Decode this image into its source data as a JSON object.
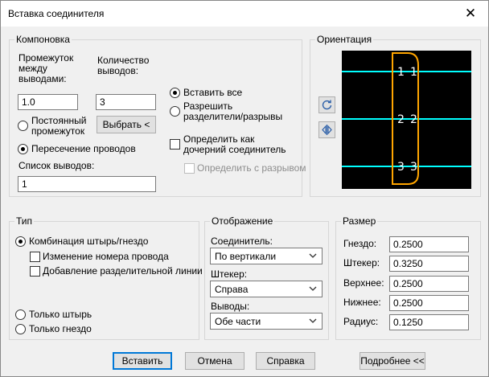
{
  "window": {
    "title": "Вставка соединителя"
  },
  "layout_group": {
    "label": "Компоновка",
    "spacing_label": "Промежуток между выводами:",
    "count_label": "Количество выводов:",
    "spacing_value": "1.0",
    "count_value": "3",
    "constant_spacing_label": "Постоянный промежуток",
    "select_button": "Выбрать <",
    "wire_intersection_label": "Пересечение проводов",
    "pin_list_label": "Список выводов:",
    "pin_list_value": "1",
    "insert_all_label": "Вставить все",
    "allow_splits_label": "Разрешить разделители/разрывы",
    "define_child_label": "Определить как дочерний соединитель",
    "define_break_label": "Определить с разрывом"
  },
  "orientation": {
    "label": "Ориентация",
    "pins": [
      {
        "left": "1",
        "right": "1"
      },
      {
        "left": "2",
        "right": "2"
      },
      {
        "left": "3",
        "right": "3"
      }
    ],
    "colors": {
      "background": "#000000",
      "wire": "#00ffff",
      "body": "#ffa500",
      "text": "#ffffff"
    },
    "rotate_icon": "rotate-icon",
    "flip_icon": "flip-icon"
  },
  "type_group": {
    "label": "Тип",
    "plug_socket_label": "Комбинация штырь/гнездо",
    "change_wire_number_label": "Изменение номера провода",
    "add_split_line_label": "Добавление разделительной линии",
    "plug_only_label": "Только штырь",
    "socket_only_label": "Только гнездо"
  },
  "display_group": {
    "label": "Отображение",
    "connector_label": "Соединитель:",
    "connector_value": "По вертикали",
    "plug_label": "Штекер:",
    "plug_value": "Справа",
    "pins_label": "Выводы:",
    "pins_value": "Обе части"
  },
  "size_group": {
    "label": "Размер",
    "socket_label": "Гнездо:",
    "socket_value": "0.2500",
    "plug_label": "Штекер:",
    "plug_value": "0.3250",
    "top_label": "Верхнее:",
    "top_value": "0.2500",
    "bottom_label": "Нижнее:",
    "bottom_value": "0.2500",
    "radius_label": "Радиус:",
    "radius_value": "0.1250"
  },
  "buttons": {
    "insert": "Вставить",
    "cancel": "Отмена",
    "help": "Справка",
    "details": "Подробнее <<"
  }
}
